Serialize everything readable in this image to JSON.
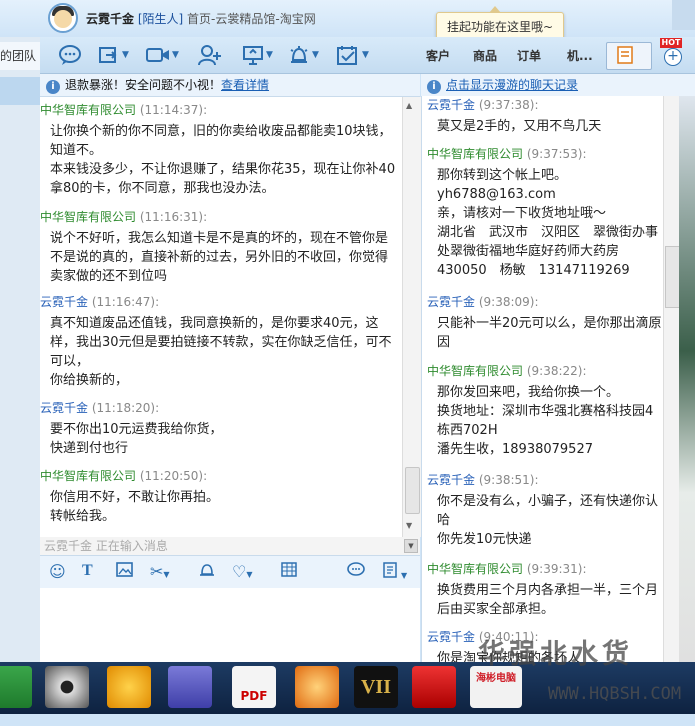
{
  "window": {
    "contact_name": "云霓千金",
    "contact_tag": "[陌生人]",
    "contact_sub": "首页-云裳精品馆-淘宝网",
    "tooltip": "挂起功能在这里哦~",
    "left_tab": "的团队"
  },
  "toolbar": {
    "icons": [
      "chat-icon",
      "share-icon",
      "video-icon",
      "add-contact-icon",
      "screen-share-icon",
      "alarm-icon",
      "task-icon"
    ],
    "nav": [
      "客户",
      "商品",
      "订单",
      "机..."
    ],
    "hot_badge": "HOT"
  },
  "notice": {
    "text": "退款暴涨！安全问题不小视！",
    "link": "查看详情"
  },
  "chat": {
    "messages": [
      {
        "sender": "中华智库有限公司",
        "time": "(11:14:37):",
        "role": "seller",
        "lines": [
          "让你换个新的你不同意，旧的你卖给收废品都能卖10块钱，知道不。",
          "本来钱没多少，不让你退赚了，结果你花35，现在让你补40拿80的卡，你不同意，那我也没办法。"
        ]
      },
      {
        "sender": "中华智库有限公司",
        "time": "(11:16:31):",
        "role": "seller",
        "lines": [
          "说个不好听，我怎么知道卡是不是真的坏的，现在不管你是不是说的真的，直接补新的过去，另外旧的不收回，你觉得卖家做的还不到位吗"
        ]
      },
      {
        "sender": "云霓千金",
        "time": "(11:16:47):",
        "role": "buyer",
        "lines": [
          "真不知道废品还值钱，我同意换新的，是你要求40元，这样，我出30元但是要拍链接不转款，实在你缺乏信任，可不可以，",
          "你给换新的，"
        ]
      },
      {
        "sender": "云霓千金",
        "time": "(11:18:20):",
        "role": "buyer",
        "lines": [
          "要不你出10元运费我给你货，",
          "快递到付也行"
        ]
      },
      {
        "sender": "中华智库有限公司",
        "time": "(11:20:50):",
        "role": "seller",
        "lines": [
          "你信用不好，不敢让你再拍。",
          "转帐给我。"
        ]
      }
    ],
    "typing_status": "云霓千金 正在输入消息"
  },
  "input_toolbar": {
    "icons": [
      "emoji-icon",
      "font-icon",
      "image-icon",
      "screenshot-icon",
      "bell-icon",
      "heart-icon",
      "table-icon",
      "quick-reply-icon",
      "history-icon"
    ]
  },
  "history": {
    "header_link": "点击显示漫游的聊天记录",
    "messages": [
      {
        "sender": "云霓千金",
        "time": "(9:37:38):",
        "role": "buyer",
        "lines": [
          "莫又是2手的，又用不鸟几天"
        ]
      },
      {
        "sender": "中华智库有限公司",
        "time": "(9:37:53):",
        "role": "seller",
        "lines": [
          "那你转到这个帐上吧。",
          "yh6788@163.com",
          "亲，请核对一下收货地址哦～",
          "湖北省　武汉市　汉阳区　翠微街办事处翠微街福地华庭好药师大药房　430050　杨敏　13147119269"
        ]
      },
      {
        "sender": "云霓千金",
        "time": "(9:38:09):",
        "role": "buyer",
        "lines": [
          "只能补一半20元可以么，是你那出滴原因"
        ]
      },
      {
        "sender": "中华智库有限公司",
        "time": "(9:38:22):",
        "role": "seller",
        "lines": [
          "那你发回来吧，我给你换一个。",
          "换货地址：深圳市华强北赛格科技园4栋西702H",
          "潘先生收，18938079527"
        ]
      },
      {
        "sender": "云霓千金",
        "time": "(9:38:51):",
        "role": "buyer",
        "lines": [
          "你不是没有么，小骗子，还有快递你认哈",
          "你先发10元快递"
        ]
      },
      {
        "sender": "中华智库有限公司",
        "time": "(9:39:31):",
        "role": "seller",
        "lines": [
          "换货费用三个月内各承担一半，三个月后由买家全部承担。"
        ]
      },
      {
        "sender": "云霓千金",
        "time": "(9:40:11):",
        "role": "buyer",
        "lines": [
          "你是淘宝你规矩的各坏人"
        ]
      }
    ]
  },
  "taskbar": {
    "apps": [
      "excel-app",
      "eye-app",
      "ksoftware-app",
      "visio-app",
      "pdf-app",
      "thunder-app",
      "game-vii-app",
      "red-app",
      "green-app"
    ],
    "app5_text": "PDF",
    "app7_text": "VII",
    "app9_text": "海彬电脑"
  },
  "watermark": {
    "text": "华强北水货",
    "url": "WWW.HQBSH.COM"
  }
}
